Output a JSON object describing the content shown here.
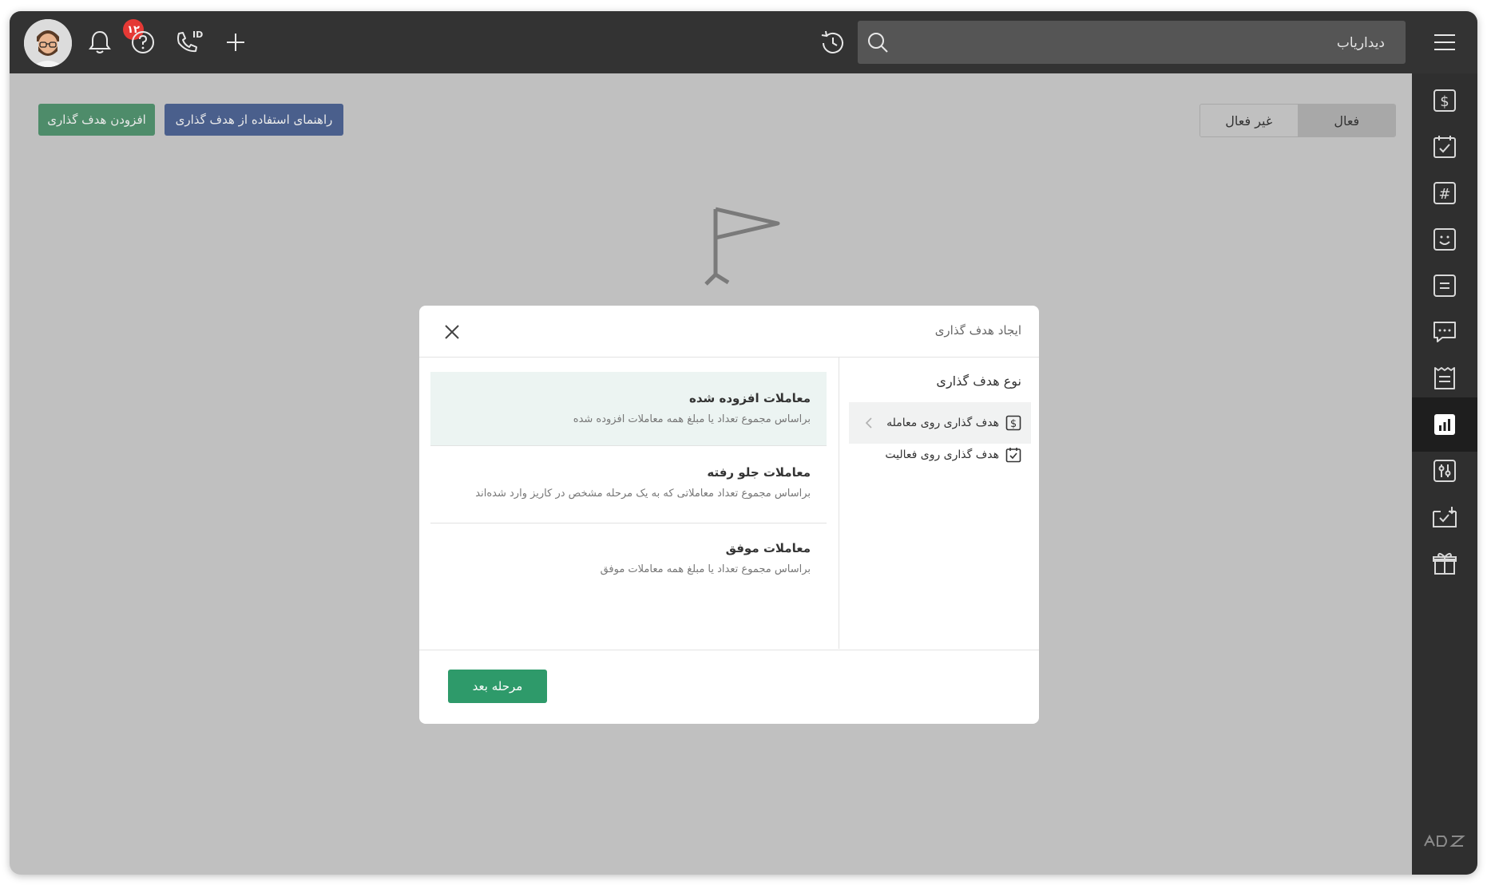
{
  "topbar": {
    "search_placeholder": "دیداریاب",
    "notification_count": "۱۲",
    "icons": [
      "menu-icon",
      "search-icon",
      "history-icon",
      "add-icon",
      "caller-id-icon",
      "help-icon",
      "bell-icon",
      "avatar"
    ]
  },
  "sidebar": {
    "items": [
      {
        "icon": "dollar-icon"
      },
      {
        "icon": "calendar-check-icon"
      },
      {
        "icon": "hashtag-icon"
      },
      {
        "icon": "smiley-icon"
      },
      {
        "icon": "notes-icon"
      },
      {
        "icon": "chat-icon"
      },
      {
        "icon": "receipt-icon"
      },
      {
        "icon": "bar-chart-icon",
        "active": true
      },
      {
        "icon": "sliders-icon"
      },
      {
        "icon": "task-sync-icon"
      },
      {
        "icon": "gift-icon"
      }
    ],
    "logo_text": "ADZ"
  },
  "page": {
    "toggle": {
      "active_label": "فعال",
      "inactive_label": "غیر فعال"
    },
    "add_goal_button": "افزودن هدف گذاری",
    "guide_button": "راهنمای استفاده از هدف گذاری"
  },
  "modal": {
    "title": "ایجاد هدف گذاری",
    "type_heading": "نوع هدف گذاری",
    "types": [
      {
        "label": "هدف گذاری روی معامله",
        "icon": "dollar-icon",
        "selected": true
      },
      {
        "label": "هدف گذاری روی فعالیت",
        "icon": "calendar-check-icon",
        "selected": false
      }
    ],
    "options": [
      {
        "title": "معاملات افزوده شده",
        "desc": "براساس مجموع تعداد یا مبلغ همه معاملات افزوده شده",
        "selected": true
      },
      {
        "title": "معاملات جلو رفته",
        "desc": "براساس مجموع تعداد معاملاتی که به یک مرحله مشخص در کاریز وارد شده‌اند",
        "selected": false
      },
      {
        "title": "معاملات موفق",
        "desc": "براساس مجموع تعداد یا مبلغ همه معاملات موفق",
        "selected": false
      }
    ],
    "next_button": "مرحله بعد"
  },
  "colors": {
    "topbar": "#333333",
    "sidebar": "#2f2f2f",
    "overlay": "#c0c0c0",
    "primary_green": "#2e9a6a",
    "guide_blue": "#4a5f8c",
    "badge_red": "#e53935",
    "selected_option_bg": "#ecf4f2"
  }
}
